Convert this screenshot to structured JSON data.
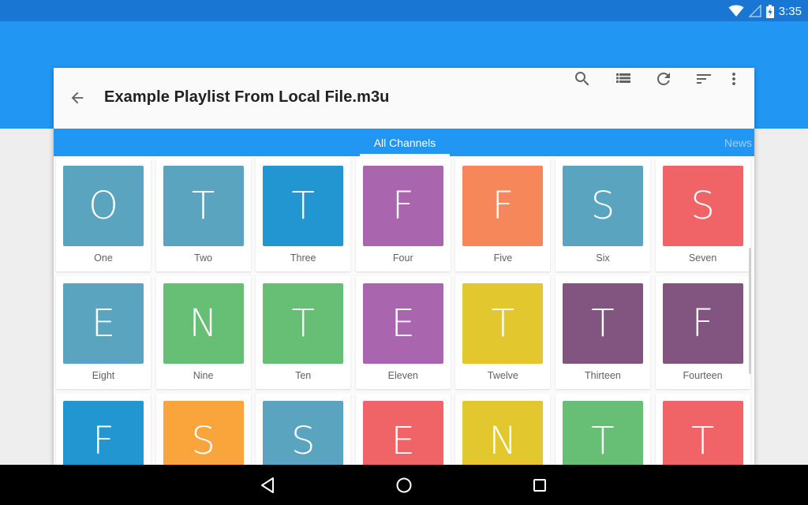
{
  "status_bar": {
    "time": "3:35",
    "icons": [
      "wifi-icon",
      "signal-icon",
      "battery-charging-icon"
    ]
  },
  "toolbar": {
    "back_icon": "arrow-back-icon",
    "title": "Example Playlist From Local File.m3u",
    "actions": [
      {
        "name": "search",
        "icon": "search-icon"
      },
      {
        "name": "list-view",
        "icon": "view-list-icon"
      },
      {
        "name": "refresh",
        "icon": "refresh-icon"
      },
      {
        "name": "sort",
        "icon": "sort-icon"
      },
      {
        "name": "more",
        "icon": "more-vert-icon"
      }
    ]
  },
  "tabs": [
    {
      "label": "All Channels",
      "active": true
    },
    {
      "label": "News",
      "active": false
    }
  ],
  "channels": [
    {
      "letter": "O",
      "label": "One",
      "color": "#5ba4bf"
    },
    {
      "letter": "T",
      "label": "Two",
      "color": "#5ba4bf"
    },
    {
      "letter": "T",
      "label": "Three",
      "color": "#2196d0"
    },
    {
      "letter": "F",
      "label": "Four",
      "color": "#a965ad"
    },
    {
      "letter": "F",
      "label": "Five",
      "color": "#f5875b"
    },
    {
      "letter": "S",
      "label": "Six",
      "color": "#5ba4bf"
    },
    {
      "letter": "S",
      "label": "Seven",
      "color": "#f06468"
    },
    {
      "letter": "E",
      "label": "Eight",
      "color": "#5ba4bf"
    },
    {
      "letter": "N",
      "label": "Nine",
      "color": "#66bf75"
    },
    {
      "letter": "T",
      "label": "Ten",
      "color": "#66bf75"
    },
    {
      "letter": "E",
      "label": "Eleven",
      "color": "#a965ad"
    },
    {
      "letter": "T",
      "label": "Twelve",
      "color": "#e2c82e"
    },
    {
      "letter": "T",
      "label": "Thirteen",
      "color": "#825480"
    },
    {
      "letter": "F",
      "label": "Fourteen",
      "color": "#825480"
    },
    {
      "letter": "F",
      "label": "",
      "color": "#2196d0"
    },
    {
      "letter": "S",
      "label": "",
      "color": "#f9a53c"
    },
    {
      "letter": "S",
      "label": "",
      "color": "#5ba4bf"
    },
    {
      "letter": "E",
      "label": "",
      "color": "#f06468"
    },
    {
      "letter": "N",
      "label": "",
      "color": "#e2c82e"
    },
    {
      "letter": "T",
      "label": "",
      "color": "#66bf75"
    },
    {
      "letter": "T",
      "label": "",
      "color": "#f06468"
    }
  ],
  "nav_bar": {
    "buttons": [
      {
        "name": "back",
        "icon": "nav-back-icon"
      },
      {
        "name": "home",
        "icon": "nav-home-icon"
      },
      {
        "name": "recents",
        "icon": "nav-recents-icon"
      }
    ]
  }
}
